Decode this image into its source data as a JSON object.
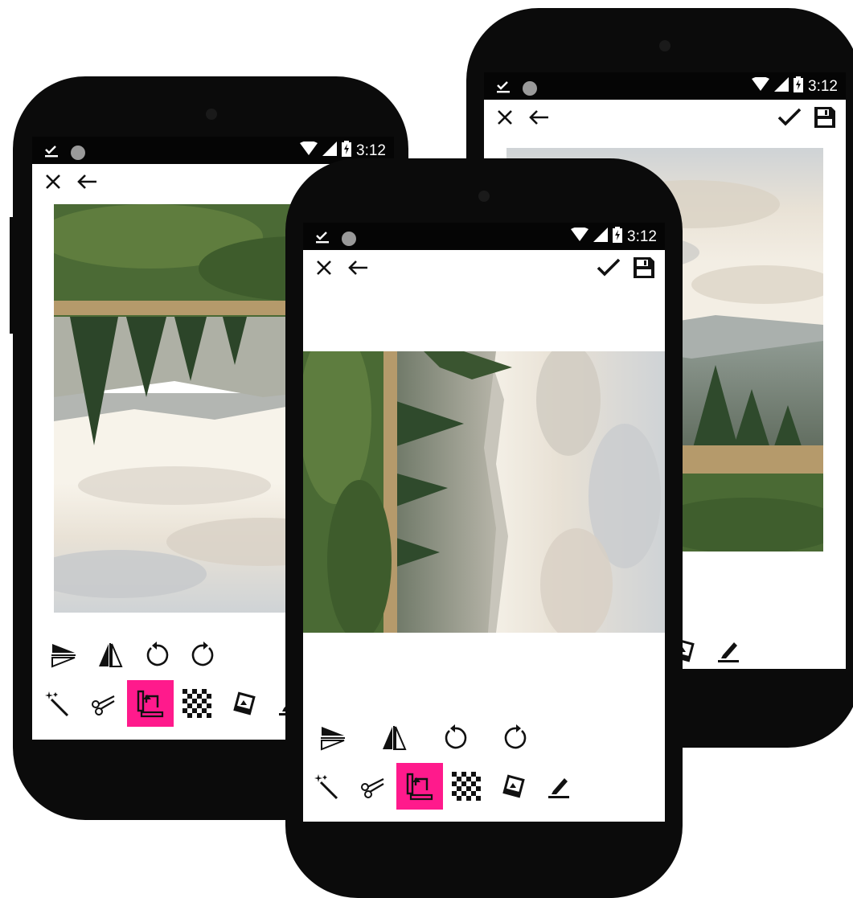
{
  "status": {
    "time": "3:12"
  },
  "icons": {
    "status_left": [
      "download-done-icon",
      "circle-icon"
    ],
    "status_right": [
      "wifi-icon",
      "signal-icon",
      "battery-charging-icon"
    ],
    "toolbar_left": [
      "close-icon",
      "back-arrow-icon"
    ],
    "toolbar_right": [
      "check-icon",
      "save-icon"
    ],
    "controls_row1": [
      "flip-vertical-icon",
      "flip-horizontal-icon",
      "rotate-left-icon",
      "rotate-right-icon"
    ],
    "controls_row2": [
      "magic-wand-icon",
      "scissors-icon",
      "rotate-crop-icon",
      "checkerboard-icon",
      "photos-icon",
      "pen-icon"
    ]
  },
  "selected_tool": "rotate-crop",
  "colors": {
    "accent": "#ff1a8c",
    "phone_body": "#0b0b0b",
    "status_bar": "#050505"
  }
}
